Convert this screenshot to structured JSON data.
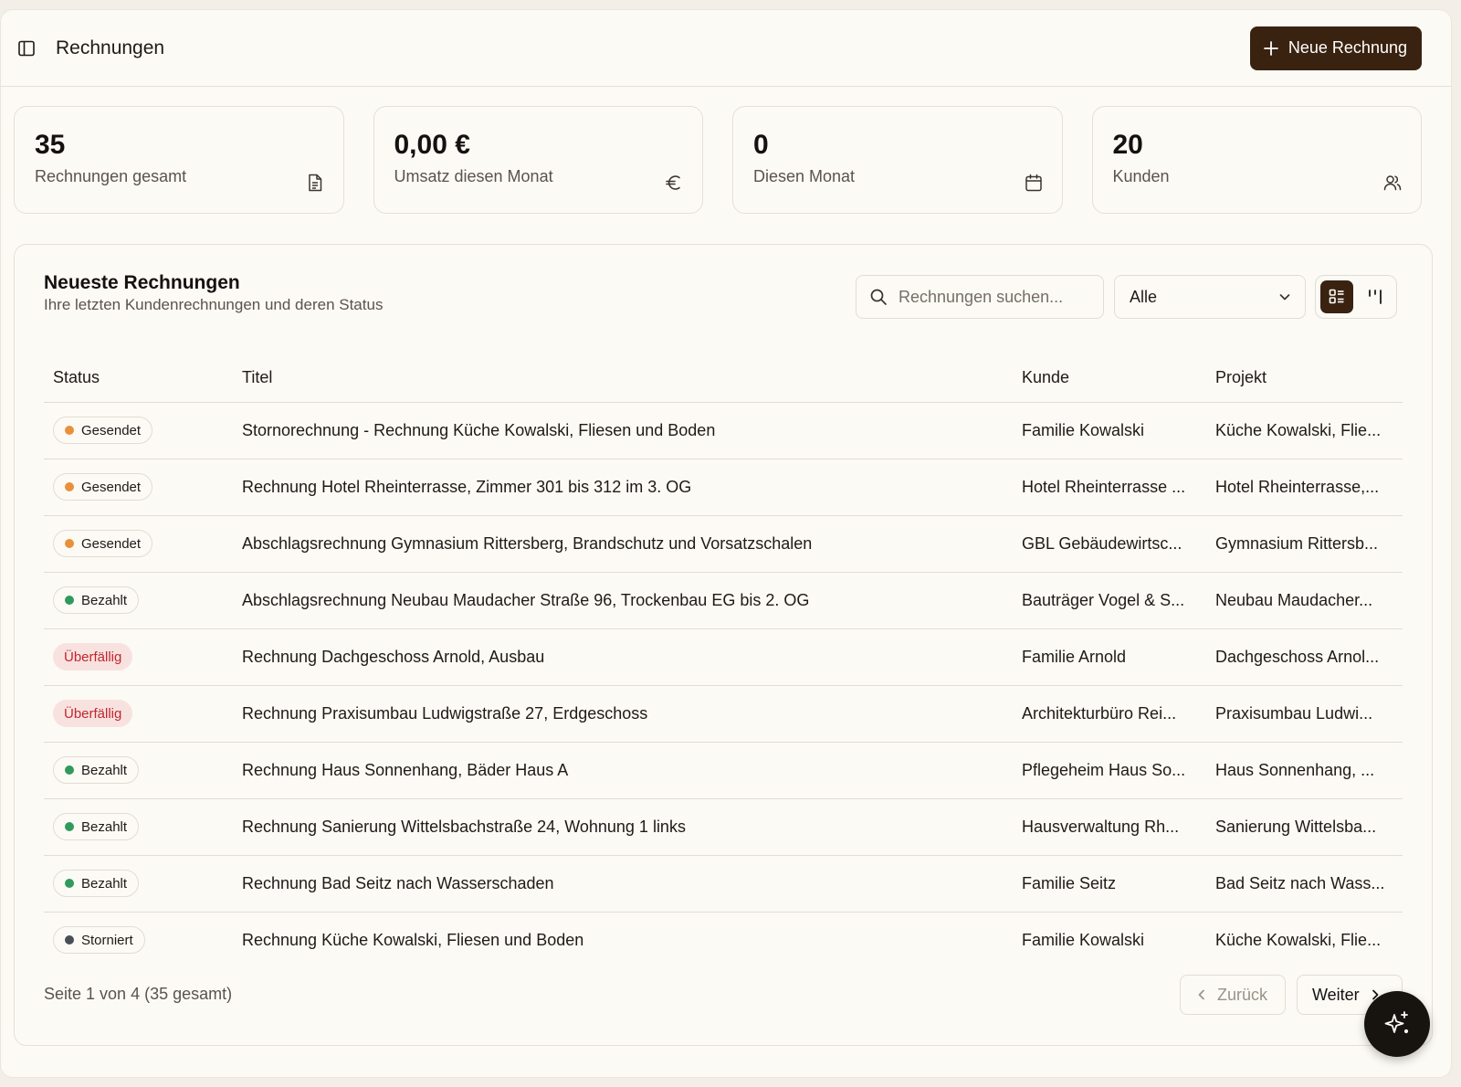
{
  "header": {
    "title": "Rechnungen",
    "new_button_label": "Neue Rechnung"
  },
  "stats": [
    {
      "value": "35",
      "label": "Rechnungen gesamt",
      "icon": "document-icon"
    },
    {
      "value": "0,00 €",
      "label": "Umsatz diesen Monat",
      "icon": "euro-icon"
    },
    {
      "value": "0",
      "label": "Diesen Monat",
      "icon": "calendar-icon"
    },
    {
      "value": "20",
      "label": "Kunden",
      "icon": "users-icon"
    }
  ],
  "panel": {
    "title": "Neueste Rechnungen",
    "subtitle": "Ihre letzten Kundenrechnungen und deren Status",
    "search_placeholder": "Rechnungen suchen...",
    "filter_value": "Alle"
  },
  "table": {
    "headers": [
      "Status",
      "Titel",
      "Kunde",
      "Projekt"
    ],
    "rows": [
      {
        "status": "Gesendet",
        "titel": "Stornorechnung - Rechnung Küche Kowalski, Fliesen und Boden",
        "kunde": "Familie Kowalski",
        "projekt": "Küche Kowalski, Flie..."
      },
      {
        "status": "Gesendet",
        "titel": "Rechnung Hotel Rheinterrasse, Zimmer 301 bis 312 im 3. OG",
        "kunde": "Hotel Rheinterrasse ...",
        "projekt": "Hotel Rheinterrasse,..."
      },
      {
        "status": "Gesendet",
        "titel": "Abschlagsrechnung Gymnasium Rittersberg, Brandschutz und Vorsatzschalen",
        "kunde": "GBL Gebäudewirtsc...",
        "projekt": "Gymnasium Rittersb..."
      },
      {
        "status": "Bezahlt",
        "titel": "Abschlagsrechnung Neubau Maudacher Straße 96, Trockenbau EG bis 2. OG",
        "kunde": "Bauträger Vogel & S...",
        "projekt": "Neubau Maudacher..."
      },
      {
        "status": "Überfällig",
        "titel": "Rechnung Dachgeschoss Arnold, Ausbau",
        "kunde": "Familie Arnold",
        "projekt": "Dachgeschoss Arnol..."
      },
      {
        "status": "Überfällig",
        "titel": "Rechnung Praxisumbau Ludwigstraße 27, Erdgeschoss",
        "kunde": "Architekturbüro Rei...",
        "projekt": "Praxisumbau Ludwi..."
      },
      {
        "status": "Bezahlt",
        "titel": "Rechnung Haus Sonnenhang, Bäder Haus A",
        "kunde": "Pflegeheim Haus So...",
        "projekt": "Haus Sonnenhang, ..."
      },
      {
        "status": "Bezahlt",
        "titel": "Rechnung Sanierung Wittelsbachstraße 24, Wohnung 1 links",
        "kunde": "Hausverwaltung Rh...",
        "projekt": "Sanierung Wittelsba..."
      },
      {
        "status": "Bezahlt",
        "titel": "Rechnung Bad Seitz nach Wasserschaden",
        "kunde": "Familie Seitz",
        "projekt": "Bad Seitz nach Wass..."
      },
      {
        "status": "Storniert",
        "titel": "Rechnung Küche Kowalski, Fliesen und Boden",
        "kunde": "Familie Kowalski",
        "projekt": "Küche Kowalski, Flie..."
      }
    ]
  },
  "status_colors": {
    "Gesendet": "#e8913a",
    "Bezahlt": "#2f9a5c",
    "Storniert": "#4a4f57",
    "Überfällig": "#c0262e"
  },
  "pagination": {
    "text": "Seite 1 von 4 (35 gesamt)",
    "prev_label": "Zurück",
    "next_label": "Weiter"
  },
  "fab_icon": "sparkles-icon"
}
